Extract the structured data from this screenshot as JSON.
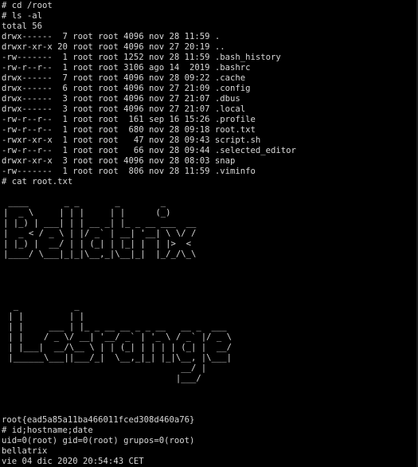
{
  "terminal": {
    "cmd_cd": "# cd /root",
    "cmd_ls": "# ls -al",
    "total": "total 56",
    "listing": [
      "drwx------  7 root root 4096 nov 28 11:59 .",
      "drwxr-xr-x 20 root root 4096 nov 27 20:19 ..",
      "-rw-------  1 root root 1252 nov 28 11:59 .bash_history",
      "-rw-r--r--  1 root root 3106 ago 14  2019 .bashrc",
      "drwx------  7 root root 4096 nov 28 09:22 .cache",
      "drwx------  6 root root 4096 nov 27 21:09 .config",
      "drwx------  3 root root 4096 nov 27 21:07 .dbus",
      "drwx------  3 root root 4096 nov 27 21:07 .local",
      "-rw-r--r--  1 root root  161 sep 16 15:26 .profile",
      "-rw-r--r--  1 root root  680 nov 28 09:18 root.txt",
      "-rwxr-xr-x  1 root root   47 nov 28 09:43 script.sh",
      "-rw-r--r--  1 root root   66 nov 28 09:44 .selected_editor",
      "drwxr-xr-x  3 root root 4096 nov 28 08:03 snap",
      "-rw-------  1 root root  806 nov 28 11:59 .viminfo"
    ],
    "cmd_cat": "# cat root.txt",
    "art_bellatrix": " ____       _ _       _        _      \n|  _ \\     | | |     | |      (_)     \n| |_) | ___| | | __ _| |_ _ __ ___  __ \n|  _ < / _ \\ | |/ _` | __| '__| \\ \\/ / \n| |_) |  __/ | | (_| | |_| |  | |>  <  \n|____/ \\___|_|_|\\__,_|\\__|_|  |_/_/\\_\\ ",
    "art_lestrange": "  _           _                            \n | |         | |                           \n | |     ___ | |_ _ __ __ _ _ __   __ _  ___ \n | |    / _ \\/ __| '__/ _` | '_ \\ / _` |/ _ \\\n | |___|  __/\\__ \\ | | (_| | | | | (_| |  __/\n |______\\___||___/_|  \\__,_|_| |_|\\__, |\\___|\n                                   __/ |     \n                                  |___/      ",
    "flag": "root{ead5a85a11ba466011fced308d460a76}",
    "cmd_id": "# id;hostname;date",
    "id_output": "uid=0(root) gid=0(root) grupos=0(root)",
    "hostname": "bellatrix",
    "date": "vie 04 dic 2020 20:54:43 CET",
    "prompt": "# "
  }
}
